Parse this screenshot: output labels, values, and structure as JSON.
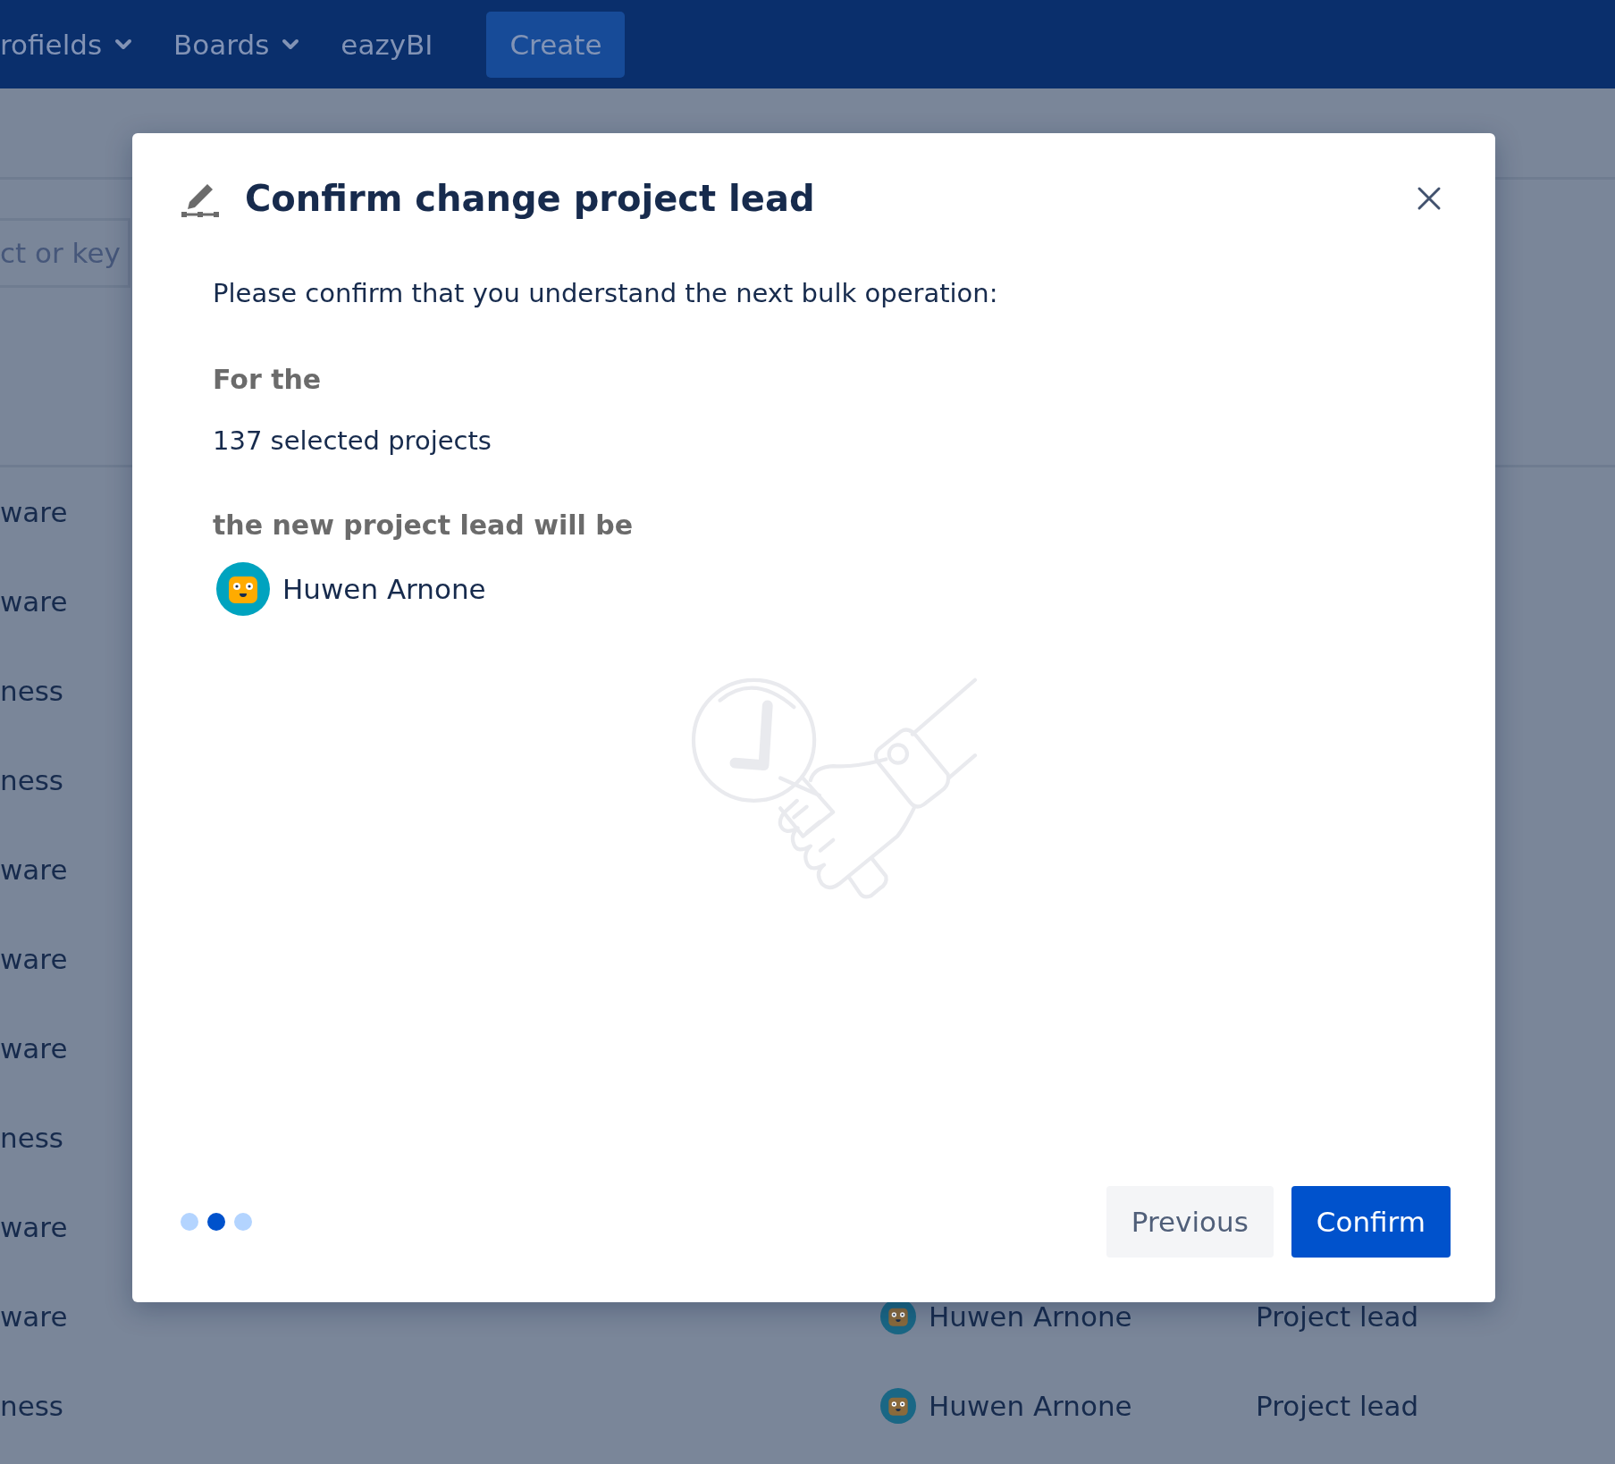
{
  "nav": {
    "items": [
      {
        "label": "rofields",
        "dropdown": true
      },
      {
        "label": "Boards",
        "dropdown": true
      },
      {
        "label": "eazyBI",
        "dropdown": false
      }
    ],
    "create_button": "Create"
  },
  "search": {
    "placeholder": "ct or key"
  },
  "rows": [
    {
      "column_1": "ware"
    },
    {
      "column_1": "ware"
    },
    {
      "column_1": "ness"
    },
    {
      "column_1": "ness"
    },
    {
      "column_1": "ware"
    },
    {
      "column_1": "ware"
    },
    {
      "column_1": "ware"
    },
    {
      "column_1": "ness"
    },
    {
      "column_1": "ware"
    },
    {
      "column_1": "ware",
      "lead": "Huwen Arnone",
      "role": "Project lead"
    },
    {
      "column_1": "ness",
      "lead": "Huwen Arnone",
      "role": "Project lead"
    }
  ],
  "dialog": {
    "title": "Confirm change project lead",
    "intro": "Please confirm that you understand the next bulk operation:",
    "for_label": "For the",
    "selection": "137 selected projects",
    "lead_label": "the new project lead will be",
    "new_lead": "Huwen Arnone",
    "steps": [
      {
        "selected": false
      },
      {
        "selected": true
      },
      {
        "selected": false
      }
    ],
    "buttons": [
      {
        "label": "Previous",
        "kind": "secondary"
      },
      {
        "label": "Confirm",
        "kind": "primary"
      }
    ]
  }
}
